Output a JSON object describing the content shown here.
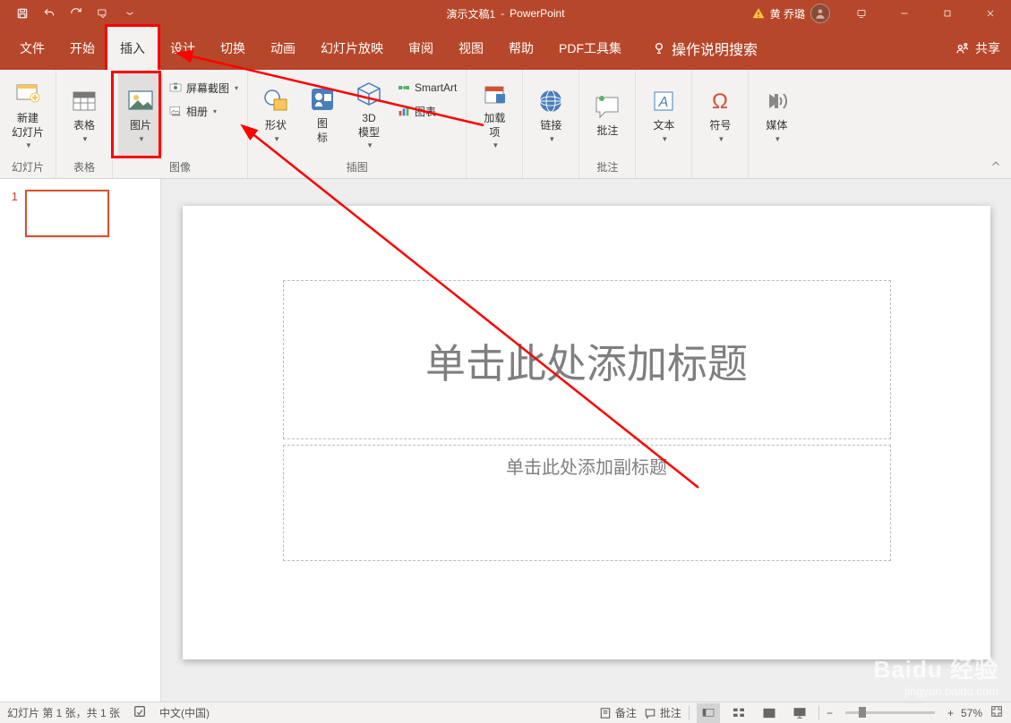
{
  "title": {
    "doc": "演示文稿1",
    "app": "PowerPoint"
  },
  "user": {
    "name": "黄 乔璐"
  },
  "tabs": {
    "file": "文件",
    "home": "开始",
    "insert": "插入",
    "design": "设计",
    "transition": "切换",
    "animation": "动画",
    "slideshow": "幻灯片放映",
    "review": "审阅",
    "view": "视图",
    "help": "帮助",
    "pdf": "PDF工具集",
    "tellme": "操作说明搜索",
    "share": "共享"
  },
  "ribbon": {
    "slides": {
      "new_slide": "新建\n幻灯片",
      "group": "幻灯片"
    },
    "tables": {
      "table": "表格",
      "group": "表格"
    },
    "images": {
      "picture": "图片",
      "screenshot": "屏幕截图",
      "album": "相册",
      "group": "图像"
    },
    "illust": {
      "shapes": "形状",
      "icons": "图\n标",
      "model3d": "3D\n模型",
      "smartart": "SmartArt",
      "chart": "图表",
      "group": "插图"
    },
    "addins": {
      "addins_btn": "加载\n项"
    },
    "links": {
      "link": "链接"
    },
    "comments": {
      "comment": "批注",
      "group": "批注"
    },
    "text": {
      "text_btn": "文本"
    },
    "symbols": {
      "symbol": "符号"
    },
    "media": {
      "media_btn": "媒体"
    }
  },
  "thumbs": {
    "num1": "1"
  },
  "slide": {
    "title_ph": "单击此处添加标题",
    "subtitle_ph": "单击此处添加副标题"
  },
  "status": {
    "slide_info": "幻灯片 第 1 张，共 1 张",
    "lang": "中文(中国)",
    "notes": "备注",
    "comments": "批注",
    "zoom": "57%"
  },
  "watermark": {
    "brand": "Baidu 经验",
    "url": "jingyan.baidu.com"
  }
}
